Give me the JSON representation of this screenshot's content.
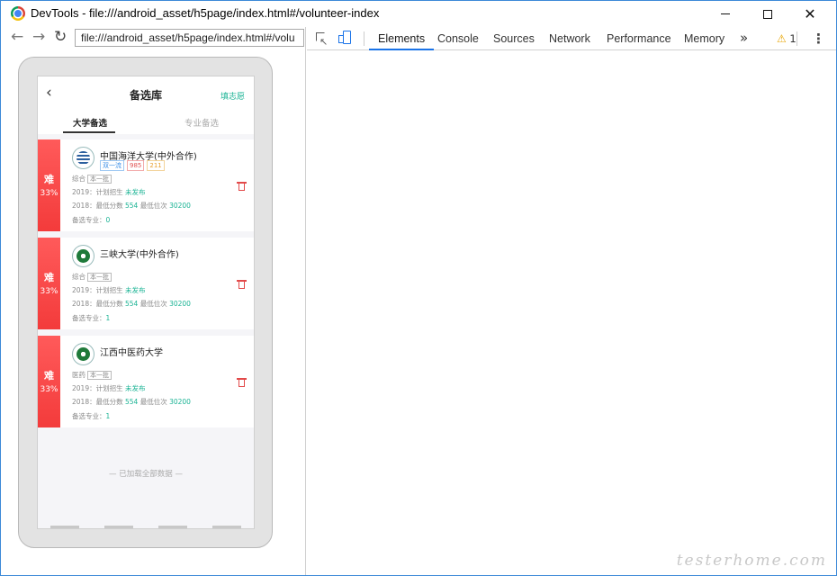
{
  "window": {
    "title": "DevTools - file:///android_asset/h5page/index.html#/volunteer-index",
    "controls": {
      "minimize": "—",
      "maximize": "☐",
      "close": "✕"
    }
  },
  "browser": {
    "url": "file:///android_asset/h5page/index.html#/volu"
  },
  "devtools": {
    "tabs": [
      "Elements",
      "Console",
      "Sources",
      "Network",
      "Performance",
      "Memory"
    ],
    "active_tab": "Elements",
    "more": "»",
    "warnings": "1"
  },
  "app": {
    "title": "备选库",
    "fill_link": "填志愿",
    "tabs": [
      "大学备选",
      "专业备选"
    ],
    "active_tab": "大学备选",
    "footer": "— 已加载全部数据 —",
    "cards": [
      {
        "difficulty": "难",
        "percent": "33%",
        "name": "中国海洋大学(中外合作)",
        "tags": [
          "双一流",
          "985",
          "211"
        ],
        "category": "综合",
        "batch": "本一批",
        "plan_prefix": "2019：计划招生",
        "plan_status": "未发布",
        "score_prefix": "2018：最低分数",
        "min_score": "554",
        "rank_label": "最低位次",
        "min_rank": "30200",
        "selected_prefix": "备选专业：",
        "selected_count": "0"
      },
      {
        "difficulty": "难",
        "percent": "33%",
        "name": "三峡大学(中外合作)",
        "tags": [],
        "category": "综合",
        "batch": "本一批",
        "plan_prefix": "2019：计划招生",
        "plan_status": "未发布",
        "score_prefix": "2018：最低分数",
        "min_score": "554",
        "rank_label": "最低位次",
        "min_rank": "30200",
        "selected_prefix": "备选专业：",
        "selected_count": "1"
      },
      {
        "difficulty": "难",
        "percent": "33%",
        "name": "江西中医药大学",
        "tags": [],
        "category": "医药",
        "batch": "本一批",
        "plan_prefix": "2019：计划招生",
        "plan_status": "未发布",
        "score_prefix": "2018：最低分数",
        "min_score": "554",
        "rank_label": "最低位次",
        "min_rank": "30200",
        "selected_prefix": "备选专业：",
        "selected_count": "1"
      }
    ]
  },
  "watermark": "testerhome.com",
  "colors": {
    "accent": "#1ab394",
    "difficulty": "#f33b3b",
    "devtools_active": "#1a73e8"
  }
}
